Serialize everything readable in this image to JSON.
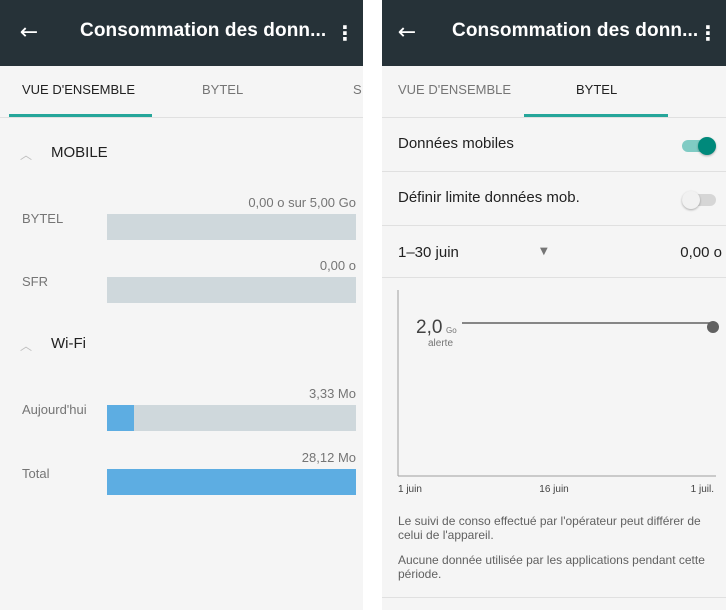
{
  "left": {
    "appbar": {
      "back_icon": "←",
      "title": "Consommation des donn...",
      "more_icon": "⋮"
    },
    "tabs": [
      {
        "label": "VUE D'ENSEMBLE",
        "active": true
      },
      {
        "label": "BYTEL",
        "active": false
      },
      {
        "label": "S",
        "active": false
      }
    ],
    "sections": [
      {
        "label": "MOBILE",
        "rows": [
          {
            "name": "BYTEL",
            "value": "0,00 o sur 5,00 Go",
            "fill": 0
          },
          {
            "name": "SFR",
            "value": "0,00 o",
            "fill": 0
          }
        ]
      },
      {
        "label": "Wi-Fi",
        "rows": [
          {
            "name": "Aujourd'hui",
            "value": "3,33 Mo",
            "fill": 0.11
          },
          {
            "name": "Total",
            "value": "28,12 Mo",
            "fill": 1.0
          }
        ]
      }
    ]
  },
  "right": {
    "appbar": {
      "back_icon": "←",
      "title": "Consommation des donn...",
      "more_icon": "⋮"
    },
    "tabs": [
      {
        "label": "VUE D'ENSEMBLE",
        "active": false
      },
      {
        "label": "BYTEL",
        "active": true
      }
    ],
    "mobile_data": {
      "label": "Données mobiles",
      "enabled": true
    },
    "limit": {
      "label": "Définir limite données mob.",
      "enabled": false
    },
    "period": {
      "label": "1–30 juin",
      "caret": "▼",
      "value": "0,00 o"
    },
    "chart_data": {
      "type": "line",
      "x_ticks": [
        "1 juin",
        "16 juin",
        "1 juil."
      ],
      "alert_value": "2,0",
      "alert_unit": "Go",
      "alert_label": "alerte",
      "series": [
        {
          "values": [
            0,
            0,
            0
          ]
        }
      ]
    },
    "note_1": "Le suivi de conso effectué par l'opérateur peut différer de celui de l'appareil.",
    "note_2": "Aucune donnée utilisée par les applications pendant cette période."
  },
  "colors": {
    "appbar": "#263238",
    "accent": "#26a69a",
    "switch_on": "#00897b",
    "bar_track": "#cfd8dc",
    "bar_fill": "#5dade2"
  }
}
